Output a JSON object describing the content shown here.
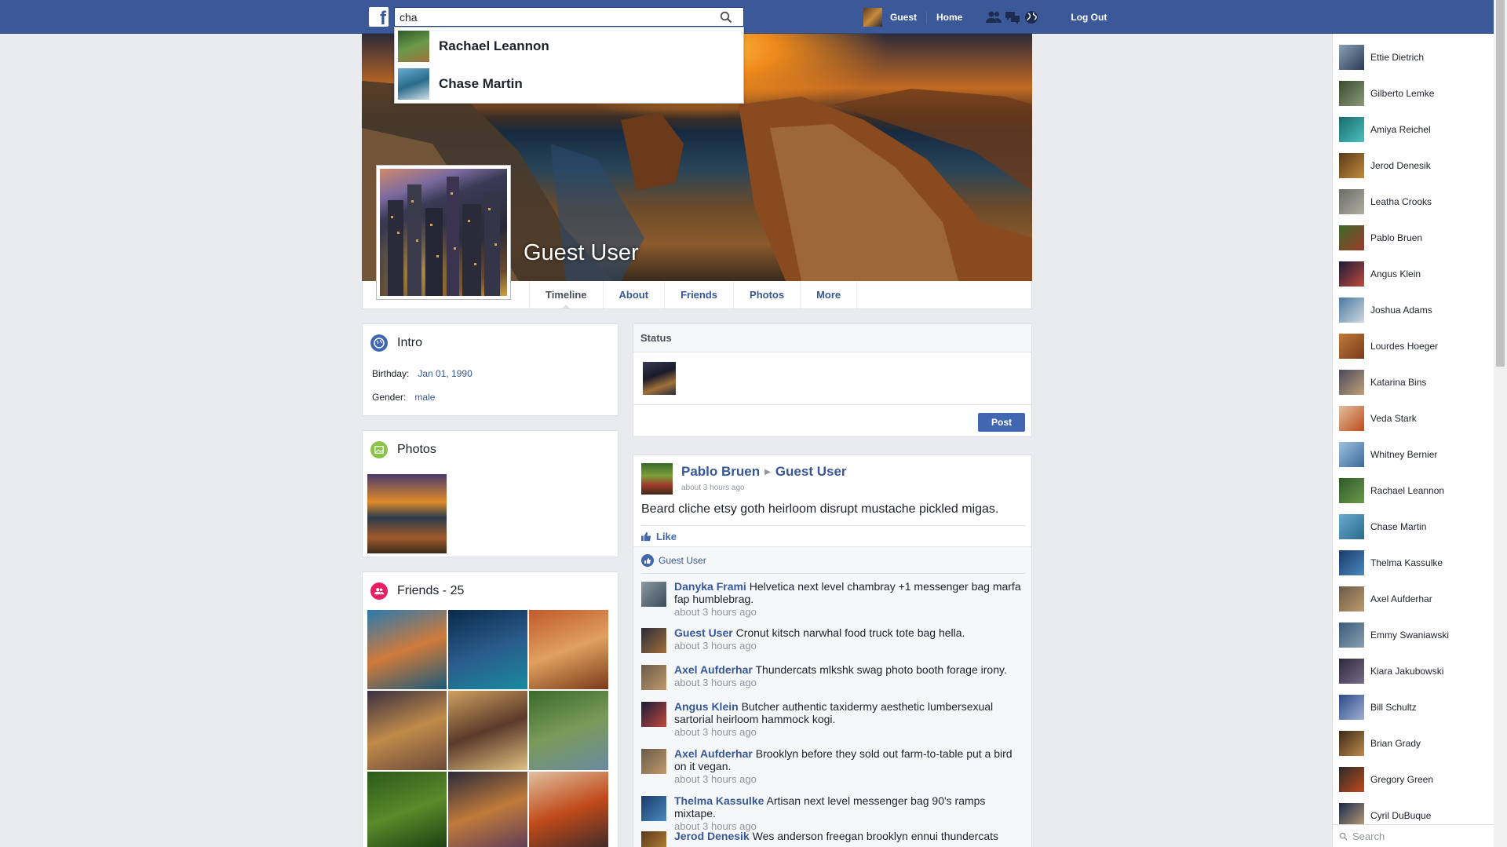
{
  "topbar": {
    "logo": "f",
    "search": {
      "value": "cha",
      "placeholder": ""
    },
    "user_name": "Guest",
    "home_label": "Home",
    "logout_label": "Log Out",
    "icons": [
      "friend-requests-icon",
      "messages-icon",
      "notifications-globe-icon"
    ]
  },
  "search_results": [
    {
      "name": "Rachael Leannon",
      "thumb": [
        "#2f5a2a",
        "#6a9a4a",
        "#a0703a"
      ]
    },
    {
      "name": "Chase Martin",
      "thumb": [
        "#6aaad0",
        "#2a6a8a",
        "#d0e0e8"
      ]
    }
  ],
  "profile": {
    "name": "Guest User",
    "tabs": [
      "Timeline",
      "About",
      "Friends",
      "Photos",
      "More"
    ],
    "active_tab": "Timeline"
  },
  "intro": {
    "title": "Intro",
    "birthday_label": "Birthday:",
    "birthday": "Jan 01, 1990",
    "gender_label": "Gender:",
    "gender": "male"
  },
  "photos": {
    "title": "Photos"
  },
  "friends": {
    "title": "Friends - 25",
    "tiles": [
      [
        "#2a7ab0",
        "#d07a3a",
        "#1a5a7a"
      ],
      [
        "#0a2a4a",
        "#2a5a8a",
        "#1a8aa0"
      ],
      [
        "#c05a2a",
        "#e0a060",
        "#7a3a1a"
      ],
      [
        "#3a3040",
        "#c08a4a",
        "#6a4a3a"
      ],
      [
        "#d0a060",
        "#5a3a2a",
        "#e0c080"
      ],
      [
        "#3a6a2a",
        "#7a9a5a",
        "#6a8aa0"
      ],
      [
        "#2a5a1a",
        "#5a8a2a",
        "#1a3a10"
      ],
      [
        "#2a2a3a",
        "#c07a3a",
        "#5a3a5a"
      ],
      [
        "#e0c0a0",
        "#c04a1a",
        "#3a2a2a"
      ]
    ]
  },
  "status": {
    "title": "Status",
    "post_label": "Post"
  },
  "post": {
    "author": "Pablo Bruen",
    "target": "Guest User",
    "time": "about 3 hours ago",
    "text": "Beard cliche etsy goth heirloom disrupt mustache pickled migas.",
    "like_label": "Like",
    "liked_by": "Guest User",
    "comments": [
      {
        "name": "Danyka Frami",
        "text": "Helvetica next level chambray +1 messenger bag marfa fap humblebrag.",
        "time": "about 3 hours ago",
        "av": [
          "#8a9aa0",
          "#3a4a5a"
        ]
      },
      {
        "name": "Guest User",
        "text": "Cronut kitsch narwhal food truck tote bag hella.",
        "time": "about 3 hours ago",
        "av": [
          "#2a2a3a",
          "#a0703a"
        ]
      },
      {
        "name": "Axel Aufderhar",
        "text": "Thundercats mlkshk swag photo booth forage irony.",
        "time": "about 3 hours ago",
        "av": [
          "#6a5a4a",
          "#c09a6a"
        ]
      },
      {
        "name": "Angus Klein",
        "text": "Butcher authentic taxidermy aesthetic lumbersexual sartorial heirloom hammock kogi.",
        "time": "about 3 hours ago",
        "av": [
          "#1a1a3a",
          "#c04a3a"
        ]
      },
      {
        "name": "Axel Aufderhar",
        "text": "Brooklyn before they sold out farm-to-table put a bird on it vegan.",
        "time": "about 3 hours ago",
        "av": [
          "#6a5a4a",
          "#c09a6a"
        ]
      },
      {
        "name": "Thelma Kassulke",
        "text": "Artisan next level messenger bag 90's ramps mixtape.",
        "time": "about 3 hours ago",
        "av": [
          "#1a3a6a",
          "#4a8ac0"
        ]
      },
      {
        "name": "Jerod Denesik",
        "text": "Wes anderson freegan brooklyn ennui thundercats",
        "time": "",
        "av": [
          "#5a3a1a",
          "#c08a3a"
        ]
      }
    ]
  },
  "chat": {
    "search_placeholder": "Search",
    "contacts": [
      {
        "name": "Ettie Dietrich",
        "av": [
          "#8aa0b0",
          "#2a3a5a"
        ]
      },
      {
        "name": "Gilberto Lemke",
        "av": [
          "#3a4a2a",
          "#8a9a7a"
        ]
      },
      {
        "name": "Amiya Reichel",
        "av": [
          "#1a6a6a",
          "#4ac0c0"
        ]
      },
      {
        "name": "Jerod Denesik",
        "av": [
          "#5a3a1a",
          "#c08a3a"
        ]
      },
      {
        "name": "Leatha Crooks",
        "av": [
          "#6a6a6a",
          "#b0b0a0"
        ]
      },
      {
        "name": "Pablo Bruen",
        "av": [
          "#3a6a2a",
          "#a03a2a"
        ]
      },
      {
        "name": "Angus Klein",
        "av": [
          "#1a1a3a",
          "#c04a3a"
        ]
      },
      {
        "name": "Joshua Adams",
        "av": [
          "#4a7aa0",
          "#d0d8e0"
        ]
      },
      {
        "name": "Lourdes Hoeger",
        "av": [
          "#c07a3a",
          "#7a3a1a"
        ]
      },
      {
        "name": "Katarina Bins",
        "av": [
          "#4a4a5a",
          "#c0a07a"
        ]
      },
      {
        "name": "Veda Stark",
        "av": [
          "#e0c0a0",
          "#c04a1a"
        ]
      },
      {
        "name": "Whitney Bernier",
        "av": [
          "#a0c0e0",
          "#3a6a9a"
        ]
      },
      {
        "name": "Rachael Leannon",
        "av": [
          "#2f5a2a",
          "#6a9a4a"
        ]
      },
      {
        "name": "Chase Martin",
        "av": [
          "#6aaad0",
          "#2a6a8a"
        ]
      },
      {
        "name": "Thelma Kassulke",
        "av": [
          "#1a3a6a",
          "#4a8ac0"
        ]
      },
      {
        "name": "Axel Aufderhar",
        "av": [
          "#6a5a4a",
          "#c09a6a"
        ]
      },
      {
        "name": "Emmy Swaniawski",
        "av": [
          "#3a5a7a",
          "#8aa0b0"
        ]
      },
      {
        "name": "Kiara Jakubowski",
        "av": [
          "#2a2a3a",
          "#7a6a8a"
        ]
      },
      {
        "name": "Bill Schultz",
        "av": [
          "#2a4a8a",
          "#a0b0d0"
        ]
      },
      {
        "name": "Brian Grady",
        "av": [
          "#3a2a1a",
          "#c08a4a"
        ]
      },
      {
        "name": "Gregory Green",
        "av": [
          "#2a2a2a",
          "#c04a1a"
        ]
      },
      {
        "name": "Cyril DuBuque",
        "av": [
          "#1a2a4a",
          "#c0a07a"
        ]
      }
    ]
  },
  "colors": {
    "brand": "#3b5998",
    "link": "#365899",
    "button": "#4267b2"
  }
}
